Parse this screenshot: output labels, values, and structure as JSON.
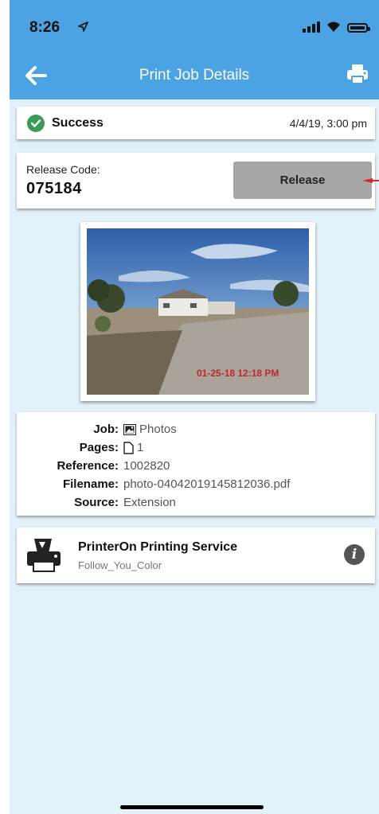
{
  "status_bar": {
    "time": "8:26",
    "location_icon": "location-arrow-icon"
  },
  "nav": {
    "title": "Print Job Details",
    "back_icon": "back-arrow-icon",
    "print_icon": "printer-icon"
  },
  "job_status": {
    "label": "Success",
    "date": "4/4/19, 3:00 pm",
    "icon": "check-circle-icon",
    "color": "#3b9a55"
  },
  "release": {
    "code_label": "Release Code:",
    "code": "075184",
    "button_label": "Release"
  },
  "photo": {
    "timestamp": "01-25-18 12:18 PM"
  },
  "details": [
    {
      "label": "Job:",
      "value": "Photos",
      "icon": "image-icon"
    },
    {
      "label": "Pages:",
      "value": "1",
      "icon": "page-icon"
    },
    {
      "label": "Reference:",
      "value": "1002820"
    },
    {
      "label": "Filename:",
      "value": "photo-04042019145812036.pdf"
    },
    {
      "label": "Source:",
      "value": "Extension"
    }
  ],
  "service": {
    "name": "PrinterOn Printing Service",
    "printer": "Follow_You_Color",
    "info_icon": "info-icon"
  },
  "colors": {
    "header": "#4ba3e3",
    "background": "#e3f1fb",
    "release_button": "#a7a7a7",
    "annotation_arrow": "#d9252b"
  }
}
